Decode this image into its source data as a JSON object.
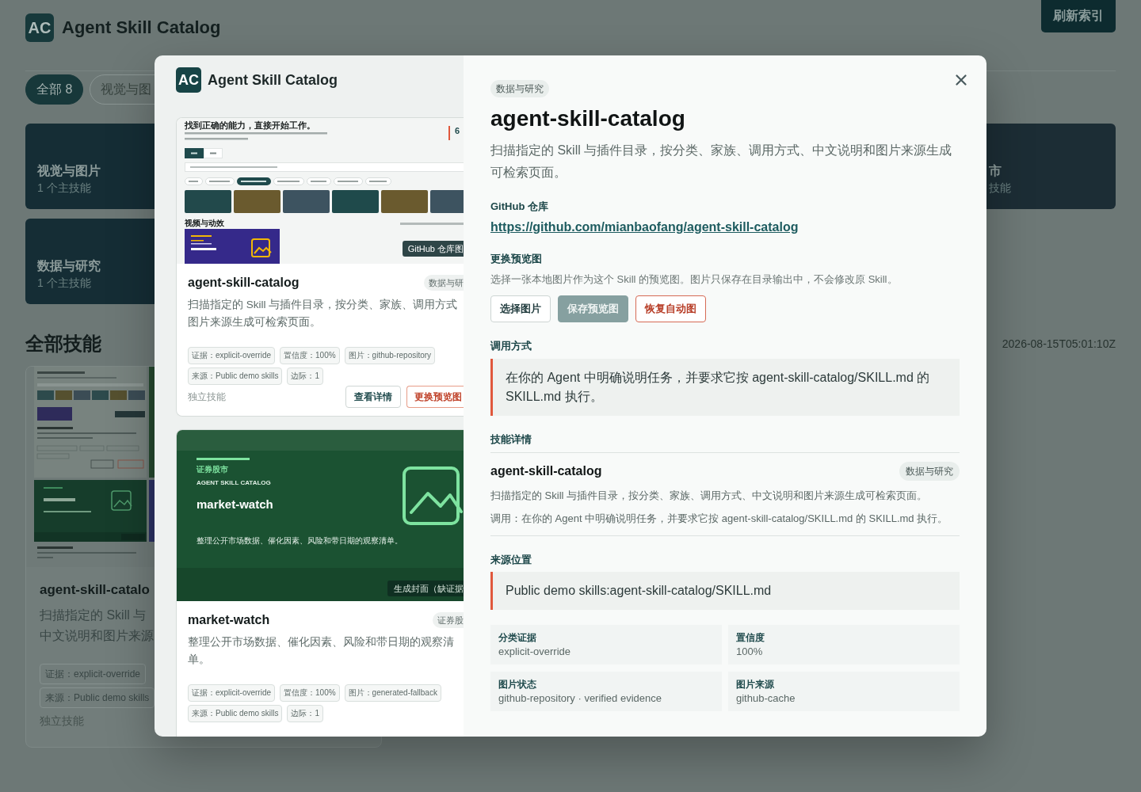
{
  "page": {
    "header": {
      "logo": "AC",
      "title": "Agent Skill Catalog",
      "refresh_button": "刷新索引"
    },
    "filters": [
      {
        "label": "全部 8",
        "selected": true
      },
      {
        "label": "视觉与图",
        "selected": false
      }
    ],
    "category_rows": [
      {
        "tiles": [
          {
            "name": "视觉与图片",
            "count": "1 个主技能"
          },
          {
            "name": "市",
            "count": "技能"
          }
        ]
      },
      {
        "tiles": [
          {
            "name": "数据与研究",
            "count": "1 个主技能"
          }
        ]
      }
    ],
    "section_title": "全部技能",
    "updated_at": "2026-08-15T05:01:10Z",
    "skill_card": {
      "title": "agent-skill-catalo",
      "description_lines": [
        "扫描指定的 Skill 与",
        "中文说明和图片来源"
      ],
      "tags": [
        "证据：explicit-override",
        "来源：Public demo skills"
      ],
      "footer": "独立技能"
    }
  },
  "modal": {
    "preview": {
      "header": {
        "logo": "AC",
        "title": "Agent Skill Catalog"
      },
      "cards": [
        {
          "cover": {
            "kind": "screenshot",
            "headline": "找到正确的能力，直接开始工作。",
            "stat": "6",
            "tiles": [
              {
                "color": "#22494b"
              },
              {
                "color": "#6a5a2e"
              },
              {
                "color": "#3d5360"
              },
              {
                "color": "#1f4a4b"
              },
              {
                "color": "#6a5a2e"
              },
              {
                "color": "#3d5360"
              }
            ],
            "section_title": "视频与动效",
            "badge": "GitHub 仓库图"
          },
          "title": "agent-skill-catalog",
          "category": "数据与研",
          "description_lines": [
            "扫描指定的 Skill 与插件目录，按分类、家族、调用方式",
            "图片来源生成可检索页面。"
          ],
          "chips": [
            "证据：explicit-override",
            "置信度：100%",
            "图片：github-repository",
            "来源：Public demo skills",
            "边际：1"
          ],
          "footer": "独立技能",
          "buttons": [
            {
              "label": "查看详情",
              "kind": "outline"
            },
            {
              "label": "更换预览图",
              "kind": "danger"
            }
          ]
        },
        {
          "cover": {
            "kind": "generated",
            "category": "证券股市",
            "brand": "AGENT SKILL CATALOG",
            "name": "market-watch",
            "summary": "整理公开市场数据、催化因素、风险和带日期的观察清单。",
            "badge": "生成封面（缺证据"
          },
          "title": "market-watch",
          "category": "证券股",
          "description_lines": [
            "整理公开市场数据、催化因素、风险和带日期的观察清",
            "单。"
          ],
          "chips": [
            "证据：explicit-override",
            "置信度：100%",
            "图片：generated-fallback",
            "来源：Public demo skills",
            "边际：1"
          ]
        }
      ]
    },
    "detail": {
      "category": "数据与研究",
      "title": "agent-skill-catalog",
      "description": "扫描指定的 Skill 与插件目录，按分类、家族、调用方式、中文说明和图片来源生成可检索页面。",
      "repo": {
        "heading": "GitHub 仓库",
        "url": "https://github.com/mianbaofang/agent-skill-catalog"
      },
      "preview_change": {
        "heading": "更换预览图",
        "hint": "选择一张本地图片作为这个 Skill 的预览图。图片只保存在目录输出中，不会修改原 Skill。",
        "buttons": [
          {
            "label": "选择图片",
            "kind": "outline",
            "disabled": false
          },
          {
            "label": "保存预览图",
            "kind": "primary",
            "disabled": true
          },
          {
            "label": "恢复自动图",
            "kind": "danger",
            "disabled": false
          }
        ]
      },
      "invocation": {
        "heading": "调用方式",
        "text": "在你的 Agent 中明确说明任务，并要求它按 agent-skill-catalog/SKILL.md 的 SKILL.md 执行。"
      },
      "skill_details": {
        "heading": "技能详情",
        "name": "agent-skill-catalog",
        "category": "数据与研究",
        "description": "扫描指定的 Skill 与插件目录，按分类、家族、调用方式、中文说明和图片来源生成可检索页面。",
        "invocation": "调用：在你的 Agent 中明确说明任务，并要求它按 agent-skill-catalog/SKILL.md 的 SKILL.md 执行。"
      },
      "source": {
        "heading": "来源位置",
        "path": "Public demo skills:agent-skill-catalog/SKILL.md"
      },
      "facts": [
        {
          "label": "分类证据",
          "value": "explicit-override"
        },
        {
          "label": "置信度",
          "value": "100%"
        },
        {
          "label": "图片状态",
          "value": "github-repository · verified evidence"
        },
        {
          "label": "图片来源",
          "value": "github-cache"
        }
      ]
    }
  }
}
